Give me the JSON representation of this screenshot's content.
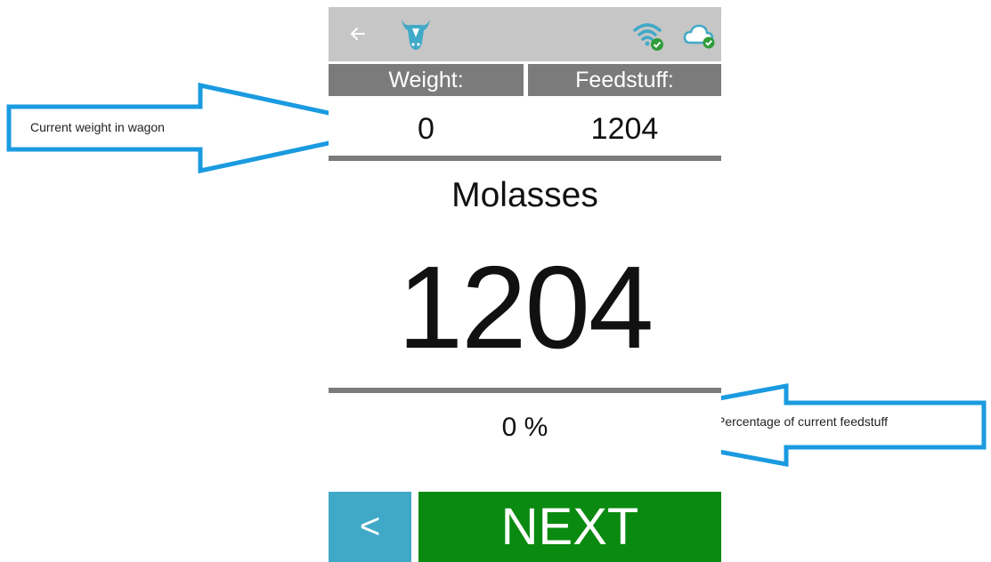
{
  "header": {
    "back_icon": "arrow-left-icon",
    "logo_icon": "cow-head-icon",
    "wifi_icon": "wifi-connected-icon",
    "cloud_icon": "cloud-synced-icon",
    "bar_color": "#c6c6c6",
    "accent_color": "#41a9c8",
    "status_ok_color": "#2e9c3a"
  },
  "columns": {
    "weight_label": "Weight:",
    "feedstuff_label": "Feedstuff:",
    "weight_value": "0",
    "feedstuff_value": "1204"
  },
  "feed": {
    "name": "Molasses",
    "amount": "1204",
    "percentage": "0 %"
  },
  "buttons": {
    "prev_label": "<",
    "next_label": "NEXT",
    "prev_color": "#41a9c8",
    "next_color": "#0a8a10"
  },
  "annotations": {
    "weight_callout": "Current weight in wagon",
    "percentage_callout": "Percentage of current feedstuff",
    "arrow_color": "#1a9be0"
  }
}
